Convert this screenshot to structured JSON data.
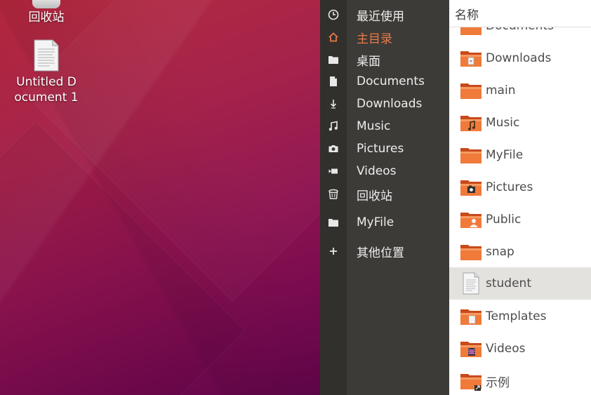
{
  "desktop": {
    "trash_label": "回收站",
    "document_label": "Untitled Document 1"
  },
  "sidebar": {
    "items": [
      {
        "label": "最近使用",
        "icon": "clock-icon"
      },
      {
        "label": "主目录",
        "icon": "home-icon",
        "active": true
      },
      {
        "label": "桌面",
        "icon": "folder-icon"
      },
      {
        "label": "Documents",
        "icon": "document-icon"
      },
      {
        "label": "Downloads",
        "icon": "download-icon"
      },
      {
        "label": "Music",
        "icon": "music-icon"
      },
      {
        "label": "Pictures",
        "icon": "camera-icon"
      },
      {
        "label": "Videos",
        "icon": "video-icon"
      },
      {
        "label": "回收站",
        "icon": "trash-icon"
      },
      {
        "label": "MyFile",
        "icon": "folder-icon"
      },
      {
        "label": "其他位置",
        "icon": "plus-icon"
      }
    ],
    "active_color": "#e8794a"
  },
  "filelist": {
    "column_name": "名称",
    "rows": [
      {
        "name": "Documents",
        "icon": "folder-documents-icon"
      },
      {
        "name": "Downloads",
        "icon": "folder-downloads-icon"
      },
      {
        "name": "main",
        "icon": "folder-icon"
      },
      {
        "name": "Music",
        "icon": "folder-music-icon"
      },
      {
        "name": "MyFile",
        "icon": "folder-icon"
      },
      {
        "name": "Pictures",
        "icon": "folder-pictures-icon"
      },
      {
        "name": "Public",
        "icon": "folder-public-icon"
      },
      {
        "name": "snap",
        "icon": "folder-icon"
      },
      {
        "name": "student",
        "icon": "text-file-icon",
        "selected": true
      },
      {
        "name": "Templates",
        "icon": "folder-templates-icon"
      },
      {
        "name": "Videos",
        "icon": "folder-videos-icon"
      },
      {
        "name": "示例",
        "icon": "folder-link-icon"
      }
    ]
  },
  "colors": {
    "sidebar_bg": "#3c3b37",
    "folder_orange": "#e85f20",
    "selected_row": "#e4e2de"
  }
}
